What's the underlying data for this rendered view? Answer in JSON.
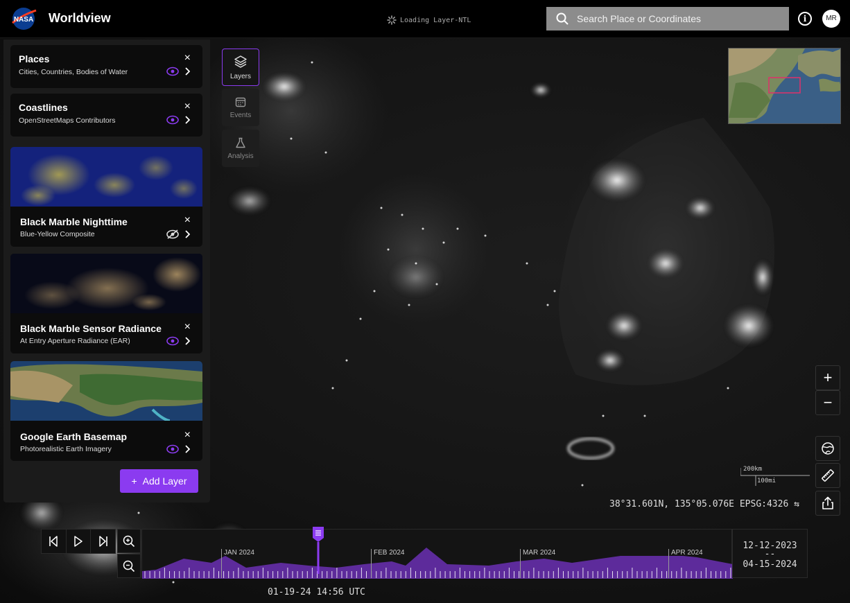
{
  "app": {
    "title": "Worldview",
    "loading_text": "Loading Layer-NTL",
    "logo_text": "NASA"
  },
  "search": {
    "placeholder": "Search Place or Coordinates"
  },
  "user": {
    "initials": "MR"
  },
  "layers": [
    {
      "name": "Places",
      "subtitle": "Cities, Countries, Bodies of Water",
      "visible": true,
      "has_thumbnail": false
    },
    {
      "name": "Coastlines",
      "subtitle": "OpenStreetMaps Contributors",
      "visible": true,
      "has_thumbnail": false
    },
    {
      "name": "Black Marble Nighttime",
      "subtitle": "Blue-Yellow Composite",
      "visible": false,
      "has_thumbnail": true
    },
    {
      "name": "Black Marble Sensor Radiance",
      "subtitle": "At Entry Aperture Radiance (EAR)",
      "visible": true,
      "has_thumbnail": true
    },
    {
      "name": "Google Earth Basemap",
      "subtitle": "Photorealistic Earth Imagery",
      "visible": true,
      "has_thumbnail": true
    }
  ],
  "add_layer_label": "Add Layer",
  "mode_tabs": [
    {
      "label": "Layers",
      "icon": "layers-icon",
      "active": true
    },
    {
      "label": "Events",
      "icon": "calendar-icon",
      "active": false
    },
    {
      "label": "Analysis",
      "icon": "flask-icon",
      "active": false
    }
  ],
  "map": {
    "scale_km": "200km",
    "scale_mi": "100mi",
    "coordinates": "38°31.601N, 135°05.076E EPSG:4326"
  },
  "timeline": {
    "months": [
      "JAN 2024",
      "FEB 2024",
      "MAR 2024",
      "APR 2024"
    ],
    "range_start": "12-12-2023",
    "range_sep": "--",
    "range_end": "04-15-2024",
    "current_time": "01-19-24 14:56 UTC"
  },
  "colors": {
    "accent": "#8b3bf0",
    "minimap_frame": "#e0306a"
  }
}
